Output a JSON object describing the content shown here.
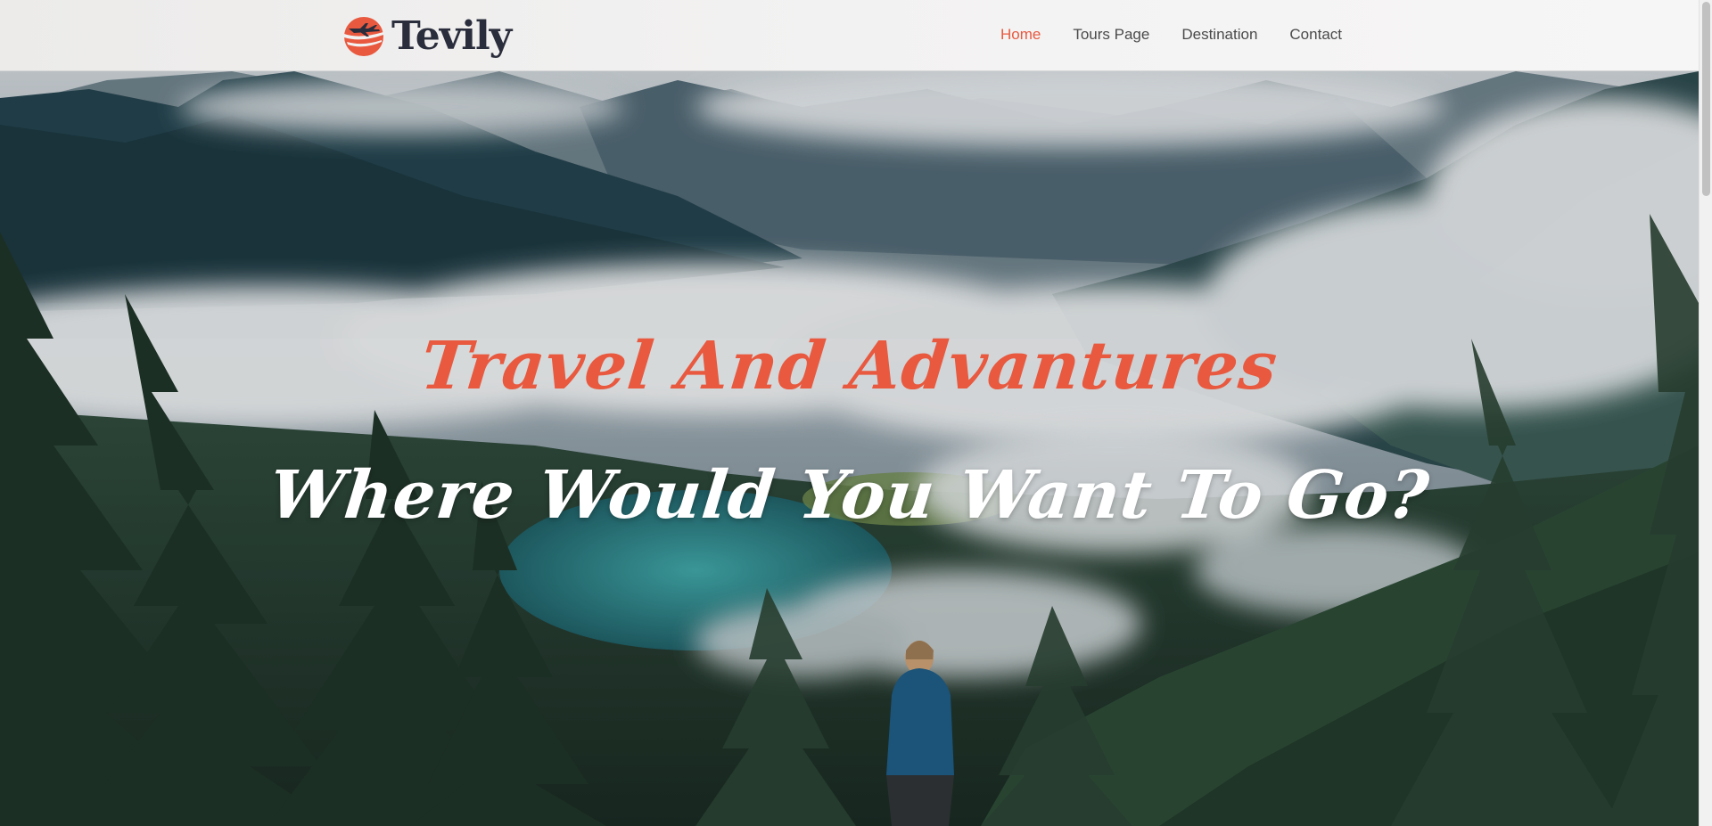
{
  "brand": {
    "name": "Tevily",
    "logo_icon": "plane-sun-logo-icon",
    "colors": {
      "accent": "#e8593f",
      "dark": "#2a2d3c"
    }
  },
  "nav": {
    "items": [
      {
        "label": "Home",
        "active": true
      },
      {
        "label": "Tours Page",
        "active": false
      },
      {
        "label": "Destination",
        "active": false
      },
      {
        "label": "Contact",
        "active": false
      }
    ]
  },
  "hero": {
    "title": "Travel And Advantures",
    "subtitle": "Where Would You Want To Go?"
  }
}
